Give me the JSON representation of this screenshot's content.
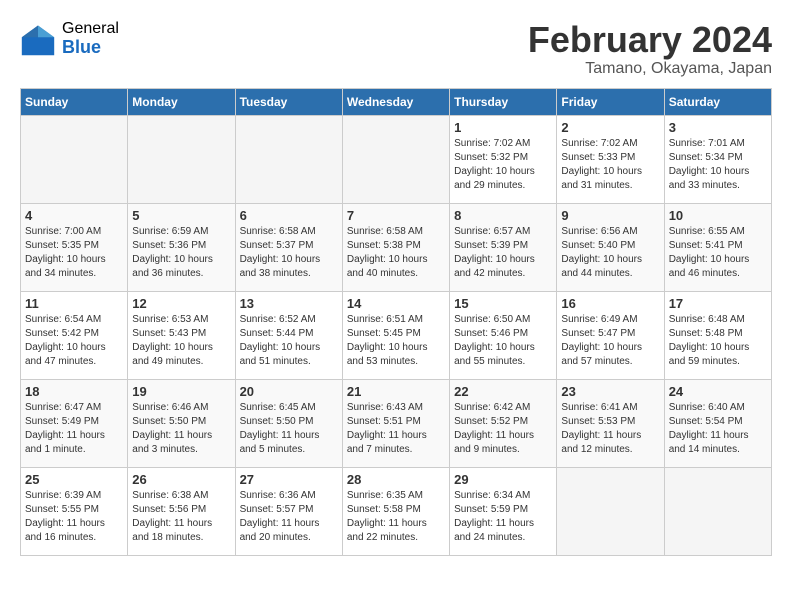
{
  "logo": {
    "general": "General",
    "blue": "Blue"
  },
  "title": {
    "month": "February 2024",
    "location": "Tamano, Okayama, Japan"
  },
  "days_of_week": [
    "Sunday",
    "Monday",
    "Tuesday",
    "Wednesday",
    "Thursday",
    "Friday",
    "Saturday"
  ],
  "weeks": [
    [
      {
        "day": "",
        "info": ""
      },
      {
        "day": "",
        "info": ""
      },
      {
        "day": "",
        "info": ""
      },
      {
        "day": "",
        "info": ""
      },
      {
        "day": "1",
        "info": "Sunrise: 7:02 AM\nSunset: 5:32 PM\nDaylight: 10 hours\nand 29 minutes."
      },
      {
        "day": "2",
        "info": "Sunrise: 7:02 AM\nSunset: 5:33 PM\nDaylight: 10 hours\nand 31 minutes."
      },
      {
        "day": "3",
        "info": "Sunrise: 7:01 AM\nSunset: 5:34 PM\nDaylight: 10 hours\nand 33 minutes."
      }
    ],
    [
      {
        "day": "4",
        "info": "Sunrise: 7:00 AM\nSunset: 5:35 PM\nDaylight: 10 hours\nand 34 minutes."
      },
      {
        "day": "5",
        "info": "Sunrise: 6:59 AM\nSunset: 5:36 PM\nDaylight: 10 hours\nand 36 minutes."
      },
      {
        "day": "6",
        "info": "Sunrise: 6:58 AM\nSunset: 5:37 PM\nDaylight: 10 hours\nand 38 minutes."
      },
      {
        "day": "7",
        "info": "Sunrise: 6:58 AM\nSunset: 5:38 PM\nDaylight: 10 hours\nand 40 minutes."
      },
      {
        "day": "8",
        "info": "Sunrise: 6:57 AM\nSunset: 5:39 PM\nDaylight: 10 hours\nand 42 minutes."
      },
      {
        "day": "9",
        "info": "Sunrise: 6:56 AM\nSunset: 5:40 PM\nDaylight: 10 hours\nand 44 minutes."
      },
      {
        "day": "10",
        "info": "Sunrise: 6:55 AM\nSunset: 5:41 PM\nDaylight: 10 hours\nand 46 minutes."
      }
    ],
    [
      {
        "day": "11",
        "info": "Sunrise: 6:54 AM\nSunset: 5:42 PM\nDaylight: 10 hours\nand 47 minutes."
      },
      {
        "day": "12",
        "info": "Sunrise: 6:53 AM\nSunset: 5:43 PM\nDaylight: 10 hours\nand 49 minutes."
      },
      {
        "day": "13",
        "info": "Sunrise: 6:52 AM\nSunset: 5:44 PM\nDaylight: 10 hours\nand 51 minutes."
      },
      {
        "day": "14",
        "info": "Sunrise: 6:51 AM\nSunset: 5:45 PM\nDaylight: 10 hours\nand 53 minutes."
      },
      {
        "day": "15",
        "info": "Sunrise: 6:50 AM\nSunset: 5:46 PM\nDaylight: 10 hours\nand 55 minutes."
      },
      {
        "day": "16",
        "info": "Sunrise: 6:49 AM\nSunset: 5:47 PM\nDaylight: 10 hours\nand 57 minutes."
      },
      {
        "day": "17",
        "info": "Sunrise: 6:48 AM\nSunset: 5:48 PM\nDaylight: 10 hours\nand 59 minutes."
      }
    ],
    [
      {
        "day": "18",
        "info": "Sunrise: 6:47 AM\nSunset: 5:49 PM\nDaylight: 11 hours\nand 1 minute."
      },
      {
        "day": "19",
        "info": "Sunrise: 6:46 AM\nSunset: 5:50 PM\nDaylight: 11 hours\nand 3 minutes."
      },
      {
        "day": "20",
        "info": "Sunrise: 6:45 AM\nSunset: 5:50 PM\nDaylight: 11 hours\nand 5 minutes."
      },
      {
        "day": "21",
        "info": "Sunrise: 6:43 AM\nSunset: 5:51 PM\nDaylight: 11 hours\nand 7 minutes."
      },
      {
        "day": "22",
        "info": "Sunrise: 6:42 AM\nSunset: 5:52 PM\nDaylight: 11 hours\nand 9 minutes."
      },
      {
        "day": "23",
        "info": "Sunrise: 6:41 AM\nSunset: 5:53 PM\nDaylight: 11 hours\nand 12 minutes."
      },
      {
        "day": "24",
        "info": "Sunrise: 6:40 AM\nSunset: 5:54 PM\nDaylight: 11 hours\nand 14 minutes."
      }
    ],
    [
      {
        "day": "25",
        "info": "Sunrise: 6:39 AM\nSunset: 5:55 PM\nDaylight: 11 hours\nand 16 minutes."
      },
      {
        "day": "26",
        "info": "Sunrise: 6:38 AM\nSunset: 5:56 PM\nDaylight: 11 hours\nand 18 minutes."
      },
      {
        "day": "27",
        "info": "Sunrise: 6:36 AM\nSunset: 5:57 PM\nDaylight: 11 hours\nand 20 minutes."
      },
      {
        "day": "28",
        "info": "Sunrise: 6:35 AM\nSunset: 5:58 PM\nDaylight: 11 hours\nand 22 minutes."
      },
      {
        "day": "29",
        "info": "Sunrise: 6:34 AM\nSunset: 5:59 PM\nDaylight: 11 hours\nand 24 minutes."
      },
      {
        "day": "",
        "info": ""
      },
      {
        "day": "",
        "info": ""
      }
    ]
  ]
}
